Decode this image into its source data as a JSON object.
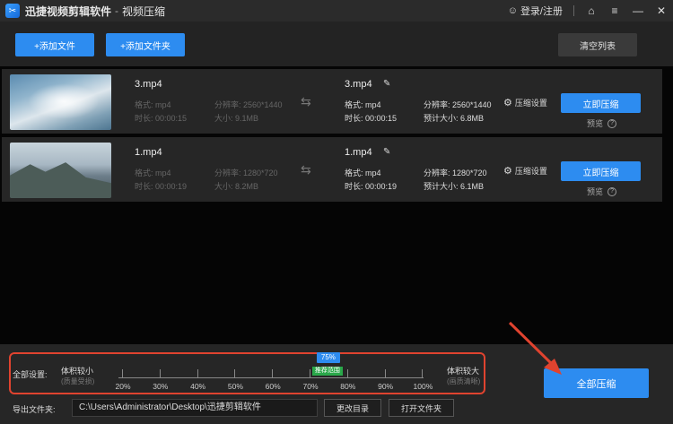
{
  "titlebar": {
    "app_name": "迅捷视频剪辑软件",
    "separator": "-",
    "subtitle": "视频压缩",
    "login_label": "登录/注册",
    "logo_icon": "scissors-icon"
  },
  "toolbar": {
    "add_file": "+添加文件",
    "add_folder": "+添加文件夹",
    "clear_list": "清空列表"
  },
  "files": [
    {
      "source": {
        "name": "3.mp4",
        "format": "格式: mp4",
        "duration": "时长: 00:00:15",
        "resolution": "分辨率: 2560*1440",
        "size": "大小: 9.1MB"
      },
      "target": {
        "name": "3.mp4",
        "format": "格式: mp4",
        "duration": "时长: 00:00:15",
        "resolution": "分辨率: 2560*1440",
        "est_size": "预计大小: 6.8MB"
      },
      "settings_label": "压缩设置",
      "compress_label": "立即压缩",
      "preview_label": "预览"
    },
    {
      "source": {
        "name": "1.mp4",
        "format": "格式: mp4",
        "duration": "时长: 00:00:19",
        "resolution": "分辨率: 1280*720",
        "size": "大小: 8.2MB"
      },
      "target": {
        "name": "1.mp4",
        "format": "格式: mp4",
        "duration": "时长: 00:00:19",
        "resolution": "分辨率: 1280*720",
        "est_size": "预计大小: 6.1MB"
      },
      "settings_label": "压缩设置",
      "compress_label": "立即压缩",
      "preview_label": "预览"
    }
  ],
  "global_settings": {
    "label": "全部设置:",
    "left_title": "体积较小",
    "left_sub": "(质量受损)",
    "right_title": "体积较大",
    "right_sub": "(画质清晰)",
    "current_value": "75%",
    "current_fraction": 0.75,
    "recommended_label": "推荐范围",
    "ticks": [
      "20%",
      "30%",
      "40%",
      "50%",
      "60%",
      "70%",
      "80%",
      "90%",
      "100%"
    ]
  },
  "output": {
    "label": "导出文件夹:",
    "path": "C:\\Users\\Administrator\\Desktop\\迅捷剪辑软件",
    "change_dir": "更改目录",
    "open_folder": "打开文件夹"
  },
  "compress_all": "全部压缩",
  "colors": {
    "accent": "#2d8cf0",
    "highlight": "#e0432f",
    "recommend": "#2aa84a"
  }
}
